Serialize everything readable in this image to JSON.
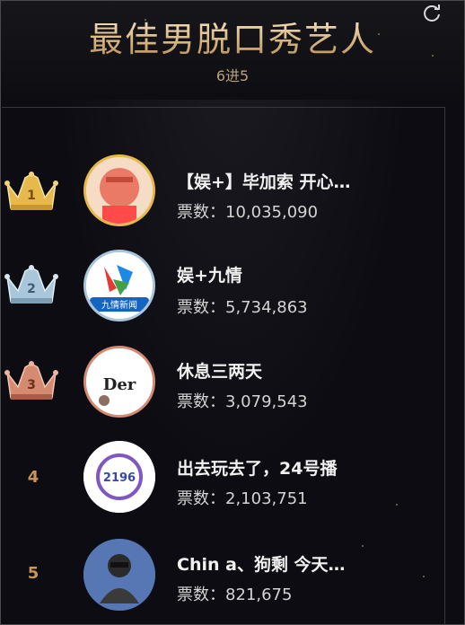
{
  "header": {
    "title": "最佳男脱口秀艺人",
    "subtitle": "6进5"
  },
  "votes_label": "票数：",
  "entries": [
    {
      "rank": "1",
      "name": "【娱+】毕加索 开心…",
      "votes": "10,035,090",
      "crown": "gold-crown-icon",
      "avatar_text": ""
    },
    {
      "rank": "2",
      "name": "娱+九情",
      "votes": "5,734,863",
      "crown": "silver-crown-icon",
      "avatar_text": "九情新闻"
    },
    {
      "rank": "3",
      "name": "休息三两天",
      "votes": "3,079,543",
      "crown": "bronze-crown-icon",
      "avatar_text": "Der"
    },
    {
      "rank": "4",
      "name": "出去玩去了，24号播",
      "votes": "2,103,751",
      "crown": "",
      "avatar_text": "2196"
    },
    {
      "rank": "5",
      "name": "Chin a、狗剩 今天…",
      "votes": "821,675",
      "crown": "",
      "avatar_text": ""
    }
  ],
  "colors": {
    "gold": "#e7b84a",
    "silver": "#a9c6da",
    "bronze": "#d48b72",
    "rank_number": "#c9945a",
    "title_gold": "#e8d3aa"
  }
}
